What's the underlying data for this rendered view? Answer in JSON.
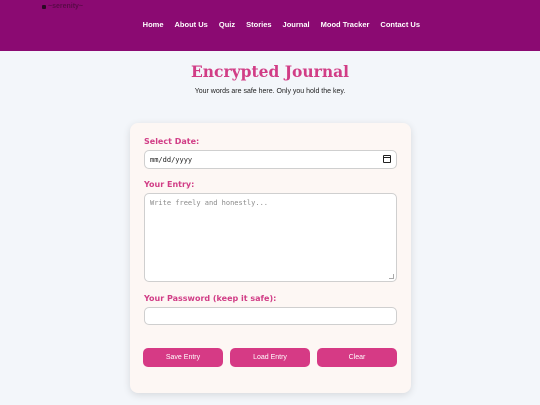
{
  "header": {
    "logo_text": "~serenity~",
    "nav": [
      "Home",
      "About Us",
      "Quiz",
      "Stories",
      "Journal",
      "Mood Tracker",
      "Contact Us"
    ]
  },
  "main": {
    "title": "Encrypted Journal",
    "subtitle": "Your words are safe here. Only you hold the key."
  },
  "form": {
    "date_label": "Select Date:",
    "date_value": "mm/dd/yyyy",
    "entry_label": "Your Entry:",
    "entry_placeholder": "Write freely and honestly...",
    "password_label": "Your Password (keep it safe):",
    "password_value": "",
    "buttons": {
      "save": "Save Entry",
      "load": "Load Entry",
      "clear": "Clear"
    }
  },
  "colors": {
    "header_bg": "#8b0a72",
    "accent": "#d13d86",
    "button": "#d63a85",
    "page_bg": "#f3f6fa",
    "card_bg": "#fdf7f4"
  }
}
